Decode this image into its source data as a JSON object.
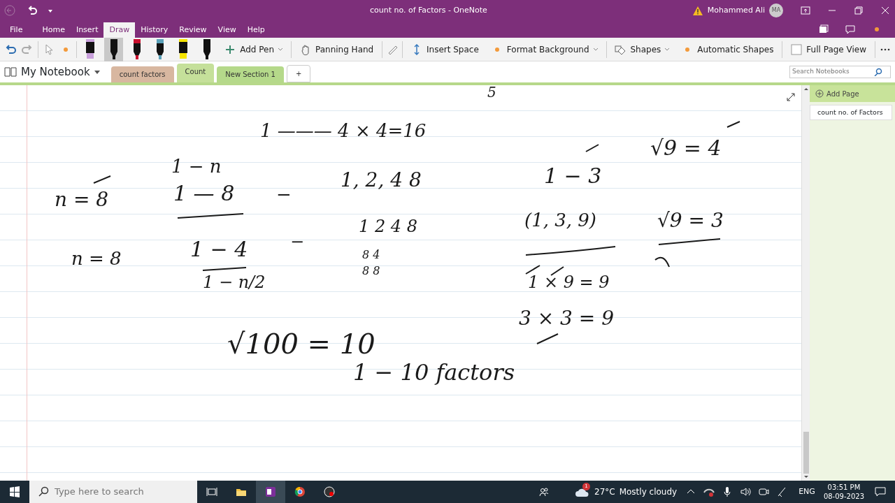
{
  "title_bar": {
    "title": "count no. of Factors  -  OneNote",
    "user_name": "Mohammed Ali",
    "user_initials": "MA"
  },
  "menu_tabs": [
    {
      "label": "File",
      "selected": false
    },
    {
      "label": "Home",
      "selected": false
    },
    {
      "label": "Insert",
      "selected": false
    },
    {
      "label": "Draw",
      "selected": true
    },
    {
      "label": "History",
      "selected": false
    },
    {
      "label": "Review",
      "selected": false
    },
    {
      "label": "View",
      "selected": false
    },
    {
      "label": "Help",
      "selected": false
    }
  ],
  "pens": [
    {
      "color": "#c9a0dc",
      "selected": false
    },
    {
      "color": "#111111",
      "selected": true
    },
    {
      "color": "#c8102e",
      "selected": false
    },
    {
      "color": "#5aa0b8",
      "selected": false
    },
    {
      "color": "#f5e400",
      "selected": false
    },
    {
      "color": "#111111",
      "selected": false
    }
  ],
  "ribbon_buttons": [
    {
      "label": "Add Pen",
      "has_dropdown": true
    },
    {
      "label": "Panning Hand",
      "has_dropdown": false
    },
    {
      "label": "Insert Space",
      "has_dropdown": false
    },
    {
      "label": "Format Background",
      "has_dropdown": true
    },
    {
      "label": "Shapes",
      "has_dropdown": true
    },
    {
      "label": "Automatic Shapes",
      "has_dropdown": false
    },
    {
      "label": "Full Page View",
      "has_dropdown": false
    }
  ],
  "notebook": {
    "name": "My Notebook"
  },
  "sections": [
    {
      "label": "count factors",
      "color": "#d8b7a0",
      "selected": false
    },
    {
      "label": "Count",
      "color": "#c5e09a",
      "selected": true
    },
    {
      "label": "New Section 1",
      "color": "#b5d98a",
      "selected": false
    },
    {
      "label": "+",
      "color": "#ffffff",
      "selected": false
    }
  ],
  "search": {
    "placeholder": "Search Notebooks"
  },
  "pages_pane": {
    "add_label": "Add Page",
    "pages": [
      {
        "title": "count no. of Factors",
        "selected": true
      }
    ]
  },
  "ink_notes": [
    {
      "text": "5"
    },
    {
      "text": "1 ——— 4 × 4=16"
    },
    {
      "text": "n = 8"
    },
    {
      "text": "1 − n"
    },
    {
      "text": "1 — 8"
    },
    {
      "text": "−"
    },
    {
      "text": "1, 2, 4 8"
    },
    {
      "text": "1 − 3"
    },
    {
      "text": "√9 = 4"
    },
    {
      "text": "1  2  4  8"
    },
    {
      "text": "(1, 3, 9)"
    },
    {
      "text": "√9 = 3"
    },
    {
      "text": "n = 8"
    },
    {
      "text": "1 − 4"
    },
    {
      "text": "−"
    },
    {
      "text": "1 − n/2"
    },
    {
      "text": "8   4"
    },
    {
      "text": "8   8"
    },
    {
      "text": "1 × 9 = 9"
    },
    {
      "text": "3 × 3 = 9"
    },
    {
      "text": "√100 = 10"
    },
    {
      "text": "1 − 10   factors"
    }
  ],
  "taskbar": {
    "search_placeholder": "Type here to search",
    "weather_badge": "1",
    "weather_temp": "27°C",
    "weather_text": "Mostly cloudy",
    "language": "ENG",
    "time": "03:51 PM",
    "date": "08-09-2023"
  }
}
